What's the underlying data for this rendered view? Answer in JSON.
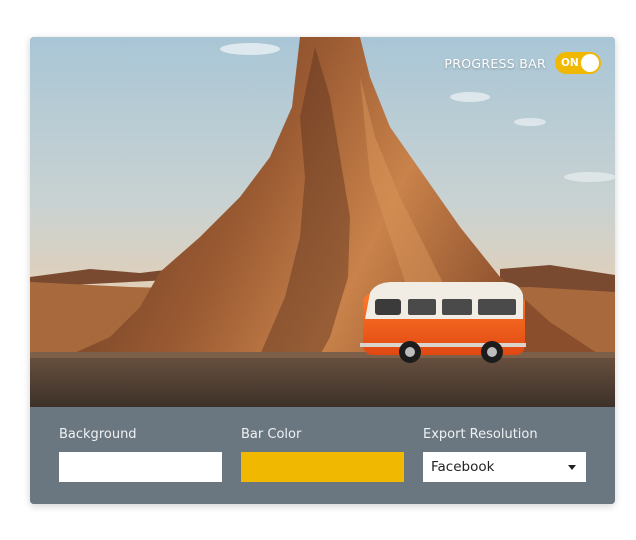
{
  "progress_bar": {
    "label": "PROGRESS BAR",
    "state": "ON",
    "enabled": true
  },
  "controls": {
    "background": {
      "label": "Background",
      "color": "#ffffff"
    },
    "bar_color": {
      "label": "Bar Color",
      "color": "#f0b800"
    },
    "export": {
      "label": "Export Resolution",
      "selected": "Facebook"
    }
  },
  "colors": {
    "accent": "#f0b800",
    "panel": "#6b7780"
  }
}
